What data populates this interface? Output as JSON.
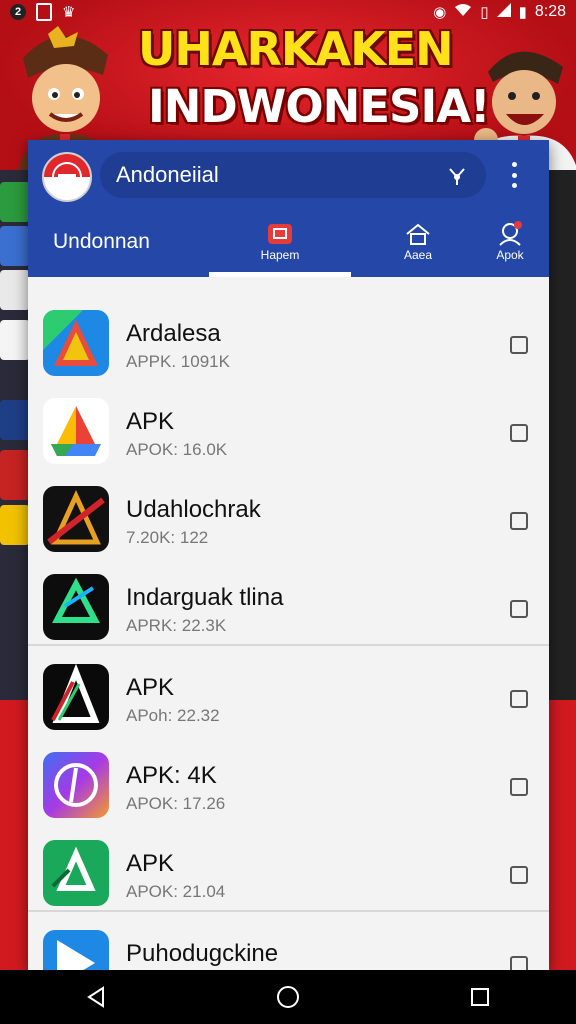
{
  "status_bar": {
    "notification_badge": "2",
    "time": "8:28",
    "icons": [
      "notification-badge-icon",
      "sim-icon",
      "crown-icon",
      "alarm-icon",
      "wifi-icon",
      "battery-icon",
      "signal-icon",
      "battery-full-icon"
    ]
  },
  "banner": {
    "title": "UHARKAKEN",
    "subtitle": "INDWONESIA!"
  },
  "app": {
    "search_text": "Andoneiial",
    "appbar_title": "Undonnan",
    "tabs": [
      {
        "label": "Hapem",
        "icon": "tv-icon",
        "active": true
      },
      {
        "label": "Aaea",
        "icon": "home-icon",
        "active": false
      },
      {
        "label": "Apok",
        "icon": "person-icon",
        "active": false
      }
    ]
  },
  "apps": [
    {
      "name": "Ardalesa",
      "meta": "APPK. 1091K",
      "icon": "apk-colorful-icon",
      "checked": false
    },
    {
      "name": "APK",
      "meta": "APOK: 16.0K",
      "icon": "apk-google-icon",
      "checked": false
    },
    {
      "name": "Udahlochrak",
      "meta": "7.20K: 122",
      "icon": "apk-dark-icon",
      "checked": false
    },
    {
      "name": "Indarguak tlina",
      "meta": "APRK: 22.3K",
      "icon": "apk-green-dark-icon",
      "checked": false
    },
    {
      "name": "APK",
      "meta": "APoh: 22.32",
      "icon": "apk-black-a-icon",
      "checked": false
    },
    {
      "name": "APK: 4K",
      "meta": "APOK: 17.26",
      "icon": "apk-purple-icon",
      "checked": false
    },
    {
      "name": "APK",
      "meta": "APOK: 21.04",
      "icon": "apk-green-icon",
      "checked": false
    },
    {
      "name": "Puhodugckine",
      "meta": "",
      "icon": "apk-blue-icon",
      "checked": false
    }
  ],
  "colors": {
    "appbar": "#2547a8",
    "banner_red": "#d11a20",
    "banner_yellow": "#ffe11a"
  }
}
